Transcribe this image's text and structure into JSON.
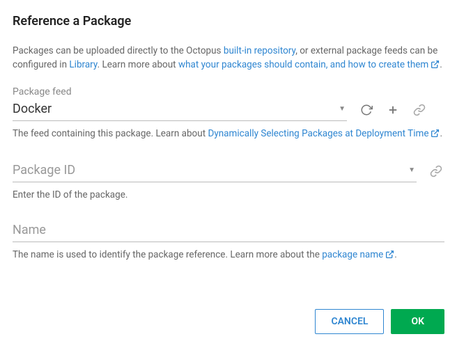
{
  "title": "Reference a Package",
  "description": {
    "text1": "Packages can be uploaded directly to the Octopus ",
    "link1": "built-in repository",
    "text2": ", or external package feeds can be configured in ",
    "link2": "Library",
    "text3": ". Learn more about ",
    "link3": "what your packages should contain, and how to create them",
    "text4": "."
  },
  "packageFeed": {
    "label": "Package feed",
    "value": "Docker",
    "helpText1": "The feed containing this package. Learn about ",
    "helpLink": "Dynamically Selecting Packages at Deployment Time",
    "helpText2": "."
  },
  "packageId": {
    "placeholder": "Package ID",
    "helpText": "Enter the ID of the package."
  },
  "name": {
    "placeholder": "Name",
    "helpText1": "The name is used to identify the package reference. Learn more about the ",
    "helpLink": "package name",
    "helpText2": "."
  },
  "buttons": {
    "cancel": "CANCEL",
    "ok": "OK"
  }
}
